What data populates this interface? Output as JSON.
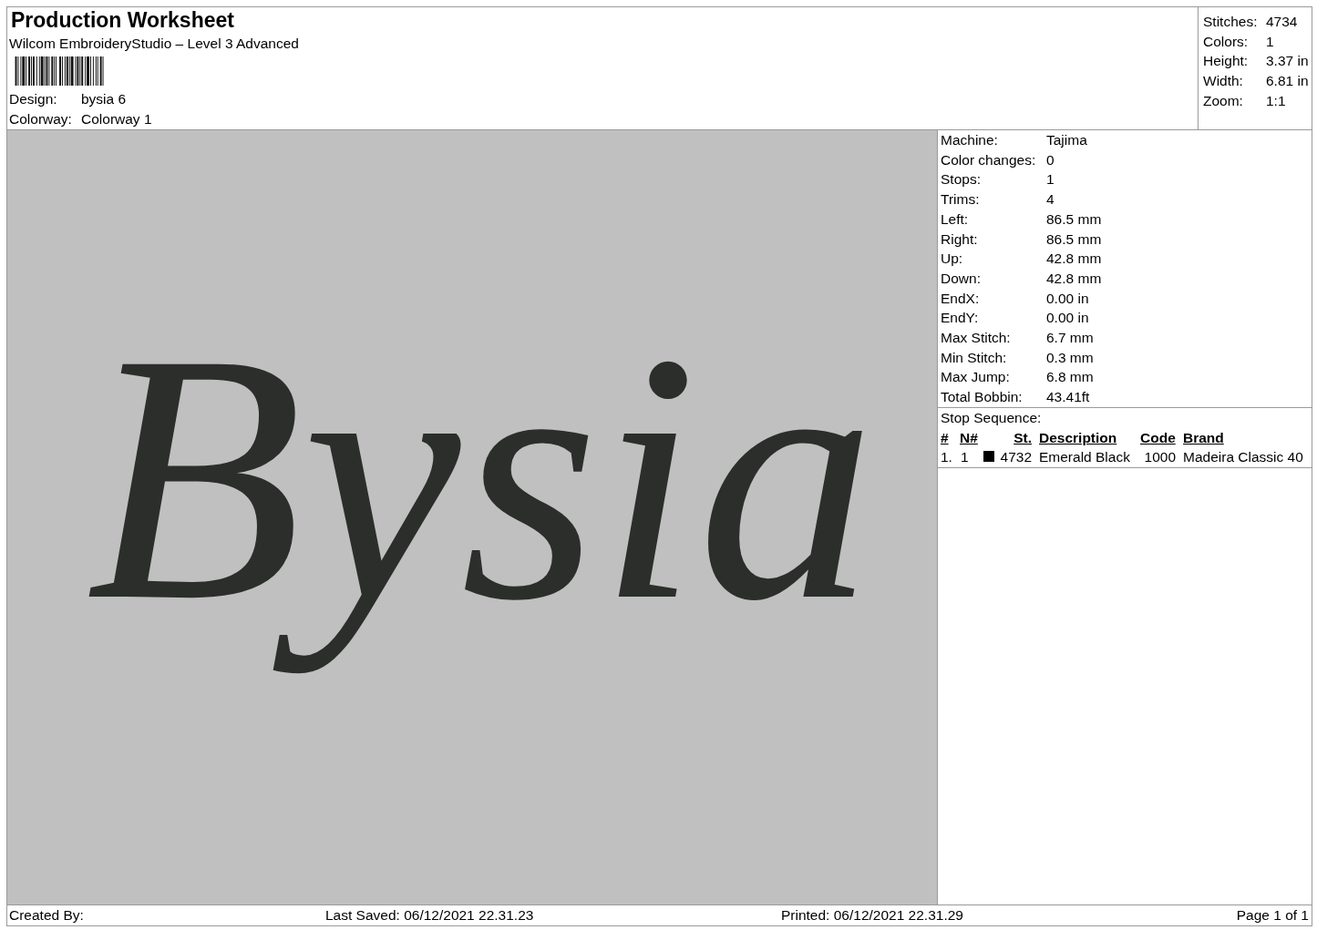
{
  "header": {
    "title": "Production Worksheet",
    "subtitle": "Wilcom EmbroideryStudio – Level 3 Advanced",
    "fields": [
      {
        "label": "Design:",
        "value": "bysia 6"
      },
      {
        "label": "Colorway:",
        "value": "Colorway 1"
      }
    ]
  },
  "summary": [
    {
      "label": "Stitches:",
      "value": "4734"
    },
    {
      "label": "Colors:",
      "value": "1"
    },
    {
      "label": "Height:",
      "value": "3.37 in"
    },
    {
      "label": "Width:",
      "value": "6.81 in"
    },
    {
      "label": "Zoom:",
      "value": "1:1"
    }
  ],
  "design_preview": {
    "text": "Bysia"
  },
  "details": [
    {
      "label": "Machine:",
      "value": "Tajima"
    },
    {
      "label": "Color changes:",
      "value": "0"
    },
    {
      "label": "Stops:",
      "value": "1"
    },
    {
      "label": "Trims:",
      "value": "4"
    },
    {
      "label": "Left:",
      "value": "86.5 mm"
    },
    {
      "label": "Right:",
      "value": "86.5 mm"
    },
    {
      "label": "Up:",
      "value": "42.8 mm"
    },
    {
      "label": "Down:",
      "value": "42.8 mm"
    },
    {
      "label": "EndX:",
      "value": "0.00 in"
    },
    {
      "label": "EndY:",
      "value": "0.00 in"
    },
    {
      "label": "Max Stitch:",
      "value": "6.7 mm"
    },
    {
      "label": "Min Stitch:",
      "value": "0.3 mm"
    },
    {
      "label": "Max Jump:",
      "value": "6.8 mm"
    },
    {
      "label": "Total Bobbin:",
      "value": "43.41ft"
    }
  ],
  "stop_sequence": {
    "title": "Stop Sequence:",
    "columns": {
      "number": "#",
      "needle": "N#",
      "stitches": "St.",
      "description": "Description",
      "code": "Code",
      "brand": "Brand"
    },
    "rows": [
      {
        "number": "1.",
        "needle": "1",
        "color": "#000000",
        "stitches": "4732",
        "description": "Emerald Black",
        "code": "1000",
        "brand": "Madeira Classic 40"
      }
    ]
  },
  "footer": {
    "created_by": "Created By:",
    "last_saved": "Last Saved: 06/12/2021 22.31.23",
    "printed": "Printed: 06/12/2021 22.31.29",
    "page": "Page 1 of 1"
  }
}
